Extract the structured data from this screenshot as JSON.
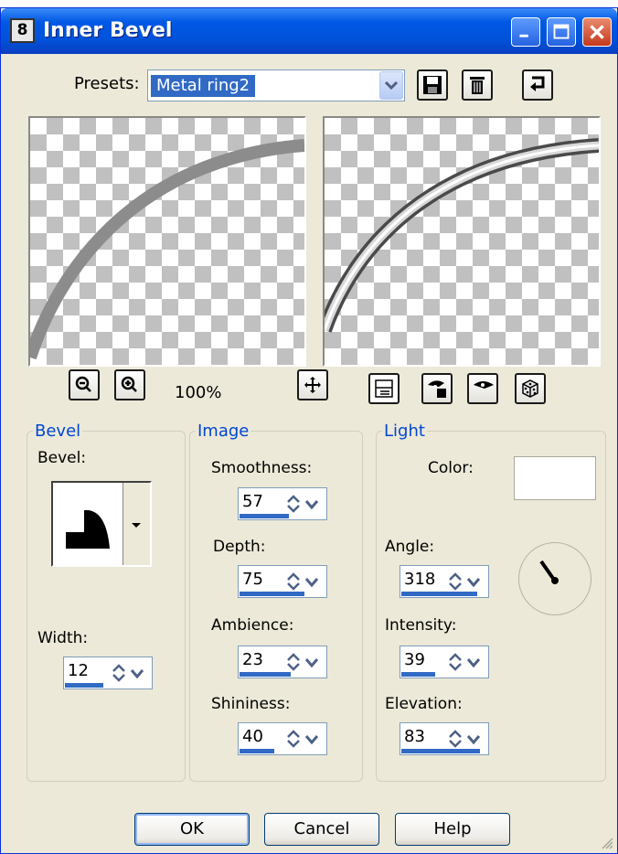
{
  "window": {
    "title": "Inner Bevel",
    "icon_label": "8"
  },
  "presets": {
    "label": "Presets:",
    "value": "Metal ring2"
  },
  "zoom": {
    "level": "100%"
  },
  "bevel": {
    "legend": "Bevel",
    "bevel_label": "Bevel:",
    "width_label": "Width:",
    "width_value": "12",
    "width_fill": 0.45
  },
  "image": {
    "legend": "Image",
    "smoothness_label": "Smoothness:",
    "smoothness_value": "57",
    "smoothness_fill": 0.57,
    "depth_label": "Depth:",
    "depth_value": "75",
    "depth_fill": 0.75,
    "ambience_label": "Ambience:",
    "ambience_value": "23",
    "ambience_fill": 0.6,
    "shininess_label": "Shininess:",
    "shininess_value": "40",
    "shininess_fill": 0.4
  },
  "light": {
    "legend": "Light",
    "color_label": "Color:",
    "color_value": "#ffffff",
    "angle_label": "Angle:",
    "angle_value": "318",
    "angle_fill": 0.88,
    "intensity_label": "Intensity:",
    "intensity_value": "39",
    "intensity_fill": 0.39,
    "elevation_label": "Elevation:",
    "elevation_value": "83",
    "elevation_fill": 0.92
  },
  "buttons": {
    "ok": "OK",
    "cancel": "Cancel",
    "help": "Help"
  },
  "colors": {
    "accent": "#316ac5",
    "title_blue": "#0052d9",
    "legend": "#0046d5",
    "face": "#ece9d8"
  },
  "icons": [
    "app-icon",
    "minimize-icon",
    "maximize-icon",
    "close-icon",
    "save-preset-icon",
    "delete-preset-icon",
    "reset-icon",
    "zoom-out-icon",
    "zoom-in-icon",
    "pan-icon",
    "proof-icon",
    "show-original-icon",
    "hide-original-icon",
    "randomize-icon"
  ]
}
